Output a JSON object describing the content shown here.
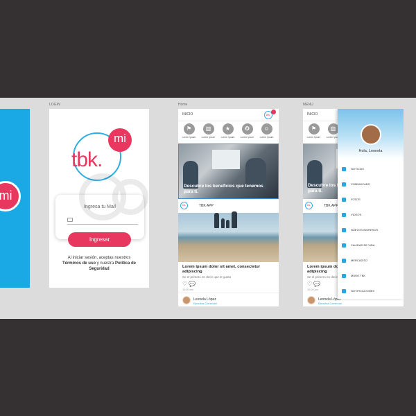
{
  "artboards": {
    "login_label": "LOGIN",
    "home_label": "Home",
    "menu_label": "MENU"
  },
  "splash": {
    "mi_text": "mi"
  },
  "login": {
    "logo_text": "tbk.",
    "logo_mi": "mi",
    "mail_label": "Ingresa tu Mail",
    "button_label": "Ingresar",
    "terms_line1": "Al iniciar sesión, aceptas nuestros",
    "terms_bold1": "Términos de uso",
    "terms_and": " y nuestra ",
    "terms_bold2": "Política de Seguridad"
  },
  "home": {
    "title": "INICIO",
    "badge": "tbk.",
    "shortcuts": [
      {
        "icon": "flag-icon",
        "glyph": "⚑",
        "label": "Lorem Ipsum"
      },
      {
        "icon": "building-icon",
        "glyph": "▥",
        "label": "Lorem Ipsum"
      },
      {
        "icon": "star-icon",
        "glyph": "★",
        "label": "Lorem Ipsum"
      },
      {
        "icon": "award-icon",
        "glyph": "✪",
        "label": "Lorem Ipsum"
      },
      {
        "icon": "smile-icon",
        "glyph": "☺",
        "label": "Lorem Ipsum"
      }
    ],
    "hero_caption": "Descubre los beneficios que tenemos para ti.",
    "feed_logo": "tbk.",
    "feed_title": "TBK APP",
    "post_title": "Lorem ipsum dolor sit amet, consectetur adipiscing",
    "post_like_text": "Se el primero en decir que te gusta",
    "post_date": "10:00 am",
    "author_name": "Leonela López",
    "author_role": "Ejecutiva Comercial"
  },
  "menu": {
    "title": "INICIO",
    "greeting": "Hola, Leonela",
    "items": [
      {
        "icon": "news-icon",
        "label": "NOTICIAS"
      },
      {
        "icon": "megaphone-icon",
        "label": "COMUNICADO"
      },
      {
        "icon": "photo-icon",
        "label": "FOTOS"
      },
      {
        "icon": "video-icon",
        "label": "VIDEOS"
      },
      {
        "icon": "new-hires-icon",
        "label": "NUEVOS INGRESOS"
      },
      {
        "icon": "heart-icon",
        "label": "CALIDAD DE VIDA"
      },
      {
        "icon": "cart-icon",
        "label": "MERCADITO"
      },
      {
        "icon": "flag-icon",
        "label": "MURO TBK"
      },
      {
        "icon": "info-icon",
        "label": "NOTIFICACIONES"
      }
    ]
  },
  "colors": {
    "brand_pink": "#e8385f",
    "brand_blue": "#2eaee0",
    "splash_blue": "#1ba9e5",
    "canvas_gray": "#dcdcdc",
    "frame_dark": "#353132"
  }
}
